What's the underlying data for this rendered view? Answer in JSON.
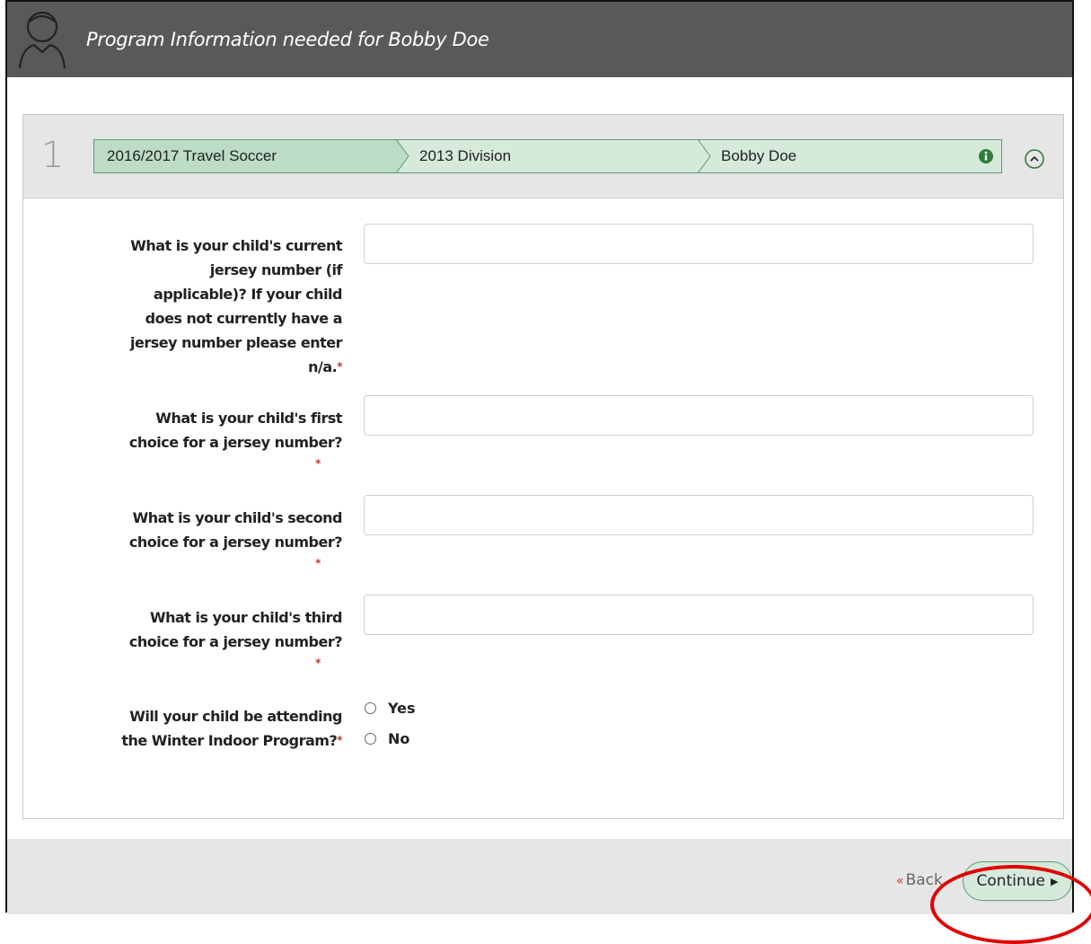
{
  "header": {
    "title": "Program Information needed for Bobby Doe",
    "avatar_icon": "person-outline-icon",
    "background": "#595959"
  },
  "step": {
    "number": "1",
    "crumbs": [
      {
        "label": "2016/2017 Travel Soccer"
      },
      {
        "label": "2013 Division"
      },
      {
        "label": "Bobby Doe"
      }
    ],
    "info_icon": "info-circle-icon",
    "collapse_icon": "chevron-up-circle-icon",
    "accent_color": "#5a9b72"
  },
  "questions": [
    {
      "label": "What is your child's current jersey number (if applicable)? If your child does not currently have a jersey number please enter n/a.",
      "required_mark": "*",
      "value": ""
    },
    {
      "label": "What is your child's first choice for a jersey number?",
      "required_mark": "*",
      "value": ""
    },
    {
      "label": "What is your child's second choice for a jersey number?",
      "required_mark": "*",
      "value": ""
    },
    {
      "label": "What is your child's third choice for a jersey number?",
      "required_mark": "*",
      "value": ""
    }
  ],
  "winter_question": {
    "label": "Will your child be attending the Winter Indoor Program?",
    "required_mark": "*",
    "options": [
      {
        "label": "Yes",
        "selected": false
      },
      {
        "label": "No",
        "selected": false
      }
    ]
  },
  "footer": {
    "back_label": "Back",
    "back_icon": "double-chevron-left-icon",
    "continue_label": "Continue",
    "continue_icon": "caret-right-icon"
  },
  "annotation": {
    "color": "#e00000"
  }
}
